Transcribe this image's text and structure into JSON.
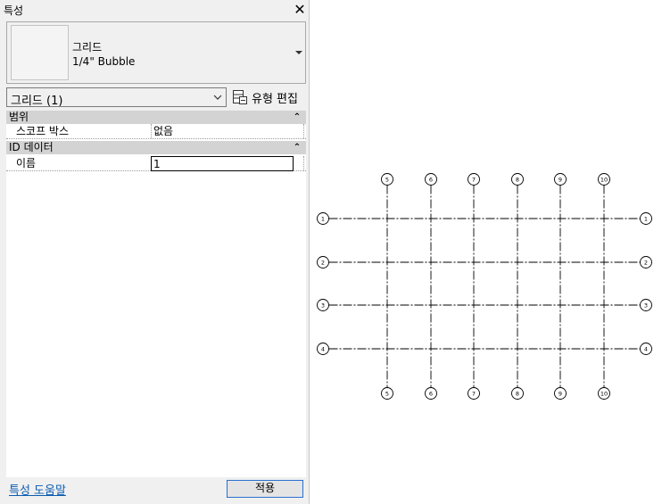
{
  "panel": {
    "title": "특성",
    "close_icon": "✕",
    "type_selector": {
      "family": "그리드",
      "type": "1/4\" Bubble"
    },
    "instance_filter": "그리드 (1)",
    "edit_type_label": "유형 편집",
    "groups": [
      {
        "label": "범위",
        "rows": [
          {
            "name": "스코프 박스",
            "value": "없음"
          }
        ]
      },
      {
        "label": "ID 데이터",
        "rows": [
          {
            "name": "이름",
            "value": "1"
          }
        ]
      }
    ],
    "help_link": "특성 도움말",
    "apply_label": "적용"
  },
  "canvas": {
    "vertical_grids": [
      "5",
      "6",
      "7",
      "8",
      "9",
      "10"
    ],
    "horizontal_grids": [
      "1",
      "2",
      "3",
      "4"
    ],
    "line_color": "#000000"
  }
}
